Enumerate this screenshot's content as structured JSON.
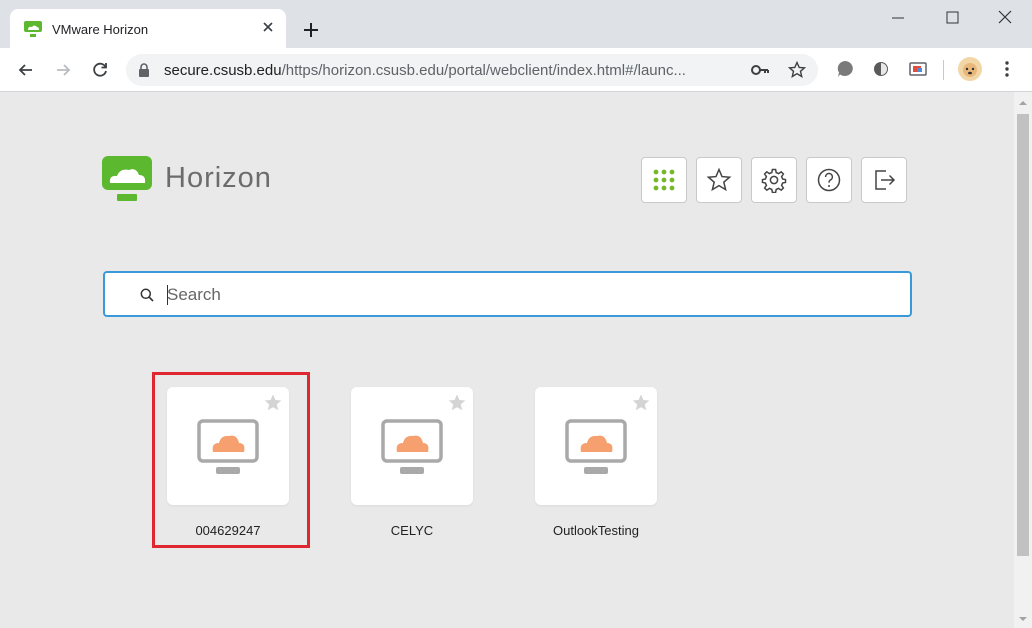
{
  "browser": {
    "tab_title": "VMware Horizon",
    "url_host": "secure.csusb.edu",
    "url_path": "/https/horizon.csusb.edu/portal/webclient/index.html#/launc..."
  },
  "header": {
    "brand": "Horizon",
    "brand_color": "#5cb82e",
    "buttons": [
      {
        "name": "apps",
        "icon": "grid-icon"
      },
      {
        "name": "favorites",
        "icon": "star-icon"
      },
      {
        "name": "settings",
        "icon": "gear-icon"
      },
      {
        "name": "help",
        "icon": "question-icon"
      },
      {
        "name": "logout",
        "icon": "logout-icon"
      }
    ]
  },
  "search": {
    "placeholder": "Search"
  },
  "apps": [
    {
      "label": "004629247",
      "selected": true
    },
    {
      "label": "CELYC",
      "selected": false
    },
    {
      "label": "OutlookTesting",
      "selected": false
    }
  ],
  "colors": {
    "accent": "#3a9ad9",
    "highlight": "#e0262e",
    "cloud": "#f5a06e"
  }
}
